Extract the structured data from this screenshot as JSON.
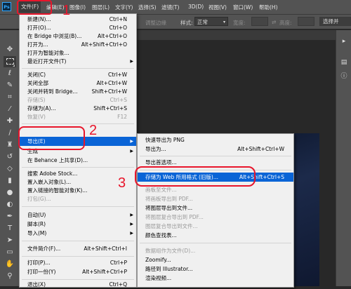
{
  "menubar": {
    "logo": "Ps",
    "items": [
      "文件(F)",
      "编辑(E)",
      "图像(I)",
      "图层(L)",
      "文字(Y)",
      "选择(S)",
      "滤镜(T)",
      "3D(D)",
      "视图(V)",
      "窗口(W)",
      "帮助(H)"
    ]
  },
  "options": {
    "feather_btn": "调整边缘",
    "style_label": "样式:",
    "style_value": "正常",
    "width_label": "宽度:",
    "height_label": "高度:",
    "select_btn": "选择并"
  },
  "file_menu": {
    "items": [
      {
        "label": "新建(N)...",
        "shortcut": "Ctrl+N"
      },
      {
        "label": "打开(O)...",
        "shortcut": "Ctrl+O"
      },
      {
        "label": "在 Bridge 中浏览(B)...",
        "shortcut": "Alt+Ctrl+O"
      },
      {
        "label": "打开为...",
        "shortcut": "Alt+Shift+Ctrl+O"
      },
      {
        "label": "打开为智能对象...",
        "shortcut": ""
      },
      {
        "label": "最近打开文件(T)",
        "shortcut": ""
      },
      {
        "label": "关闭(C)",
        "shortcut": "Ctrl+W"
      },
      {
        "label": "关闭全部",
        "shortcut": "Alt+Ctrl+W"
      },
      {
        "label": "关闭并转到 Bridge...",
        "shortcut": "Shift+Ctrl+W"
      },
      {
        "label": "存储(S)",
        "shortcut": "Ctrl+S"
      },
      {
        "label": "存储为(A)...",
        "shortcut": "Shift+Ctrl+S"
      },
      {
        "label": "恢复(V)",
        "shortcut": "F12"
      },
      {
        "label": "导出(E)",
        "shortcut": ""
      },
      {
        "label": "生成",
        "shortcut": ""
      },
      {
        "label": "在 Behance 上共享(D)...",
        "shortcut": ""
      },
      {
        "label": "搜索 Adobe Stock...",
        "shortcut": ""
      },
      {
        "label": "置入嵌入对象(L)...",
        "shortcut": ""
      },
      {
        "label": "置入链接的智能对象(K)...",
        "shortcut": ""
      },
      {
        "label": "打包(G)...",
        "shortcut": ""
      },
      {
        "label": "自动(U)",
        "shortcut": ""
      },
      {
        "label": "脚本(R)",
        "shortcut": ""
      },
      {
        "label": "导入(M)",
        "shortcut": ""
      },
      {
        "label": "文件简介(F)...",
        "shortcut": "Alt+Shift+Ctrl+I"
      },
      {
        "label": "打印(P)...",
        "shortcut": "Ctrl+P"
      },
      {
        "label": "打印一份(Y)",
        "shortcut": "Alt+Shift+Ctrl+P"
      },
      {
        "label": "退出(X)",
        "shortcut": "Ctrl+Q"
      }
    ]
  },
  "export_menu": {
    "items": [
      {
        "label": "快速导出为 PNG",
        "shortcut": ""
      },
      {
        "label": "导出为...",
        "shortcut": "Alt+Shift+Ctrl+W"
      },
      {
        "label": "导出首选项...",
        "shortcut": ""
      },
      {
        "label": "存储为 Web 所用格式 (旧版)...",
        "shortcut": "Alt+Shift+Ctrl+S"
      },
      {
        "label": "画板至文件...",
        "shortcut": ""
      },
      {
        "label": "将画板导出到 PDF...",
        "shortcut": ""
      },
      {
        "label": "将图层导出到文件...",
        "shortcut": ""
      },
      {
        "label": "将图层复合导出到 PDF...",
        "shortcut": ""
      },
      {
        "label": "图层复合导出到文件...",
        "shortcut": ""
      },
      {
        "label": "颜色查找表...",
        "shortcut": ""
      },
      {
        "label": "数据组作为文件(D)...",
        "shortcut": ""
      },
      {
        "label": "Zoomify...",
        "shortcut": ""
      },
      {
        "label": "路径到 Illustrator...",
        "shortcut": ""
      },
      {
        "label": "渲染视频...",
        "shortcut": ""
      }
    ]
  },
  "annotations": {
    "n1": "1",
    "n2": "2",
    "n3": "3"
  },
  "colors": {
    "highlight": "#0a64d6",
    "annotation": "#e8152b",
    "menu_bg": "#f0f0f0",
    "chrome": "#535353"
  },
  "icons": {
    "tools": [
      "move-icon",
      "marquee-icon",
      "lasso-icon",
      "quick-select-icon",
      "crop-icon",
      "eyedropper-icon",
      "healing-brush-icon",
      "brush-icon",
      "clone-stamp-icon",
      "history-brush-icon",
      "eraser-icon",
      "gradient-icon",
      "blur-icon",
      "dodge-icon",
      "pen-icon",
      "type-icon",
      "path-select-icon",
      "rectangle-icon",
      "hand-icon",
      "zoom-icon"
    ]
  }
}
